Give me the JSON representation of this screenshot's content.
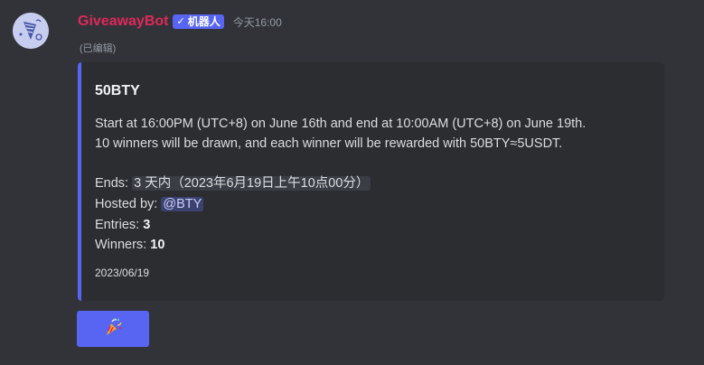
{
  "message": {
    "author": "GiveawayBot",
    "bot_badge": "机器人",
    "timestamp": "今天16:00",
    "edited_label": "(已编辑)"
  },
  "embed": {
    "accent_color": "#5865f2",
    "title": "50BTY",
    "description_line1": "Start at 16:00PM (UTC+8) on June 16th and end at 10:00AM (UTC+8) on June 19th.",
    "description_line2": "10 winners will be drawn, and each winner will be rewarded with 50BTY≈5USDT.",
    "ends_label": "Ends: ",
    "ends_relative": "3 天内",
    "ends_absolute": "（2023年6月19日上午10点00分）",
    "hosted_label": "Hosted by: ",
    "host": "@BTY",
    "entries_label": "Entries: ",
    "entries": "3",
    "winners_label": "Winners: ",
    "winners": "10",
    "footer_date": "2023/06/19"
  },
  "button": {
    "icon": "party-popper-icon",
    "color": "#5865f2"
  }
}
